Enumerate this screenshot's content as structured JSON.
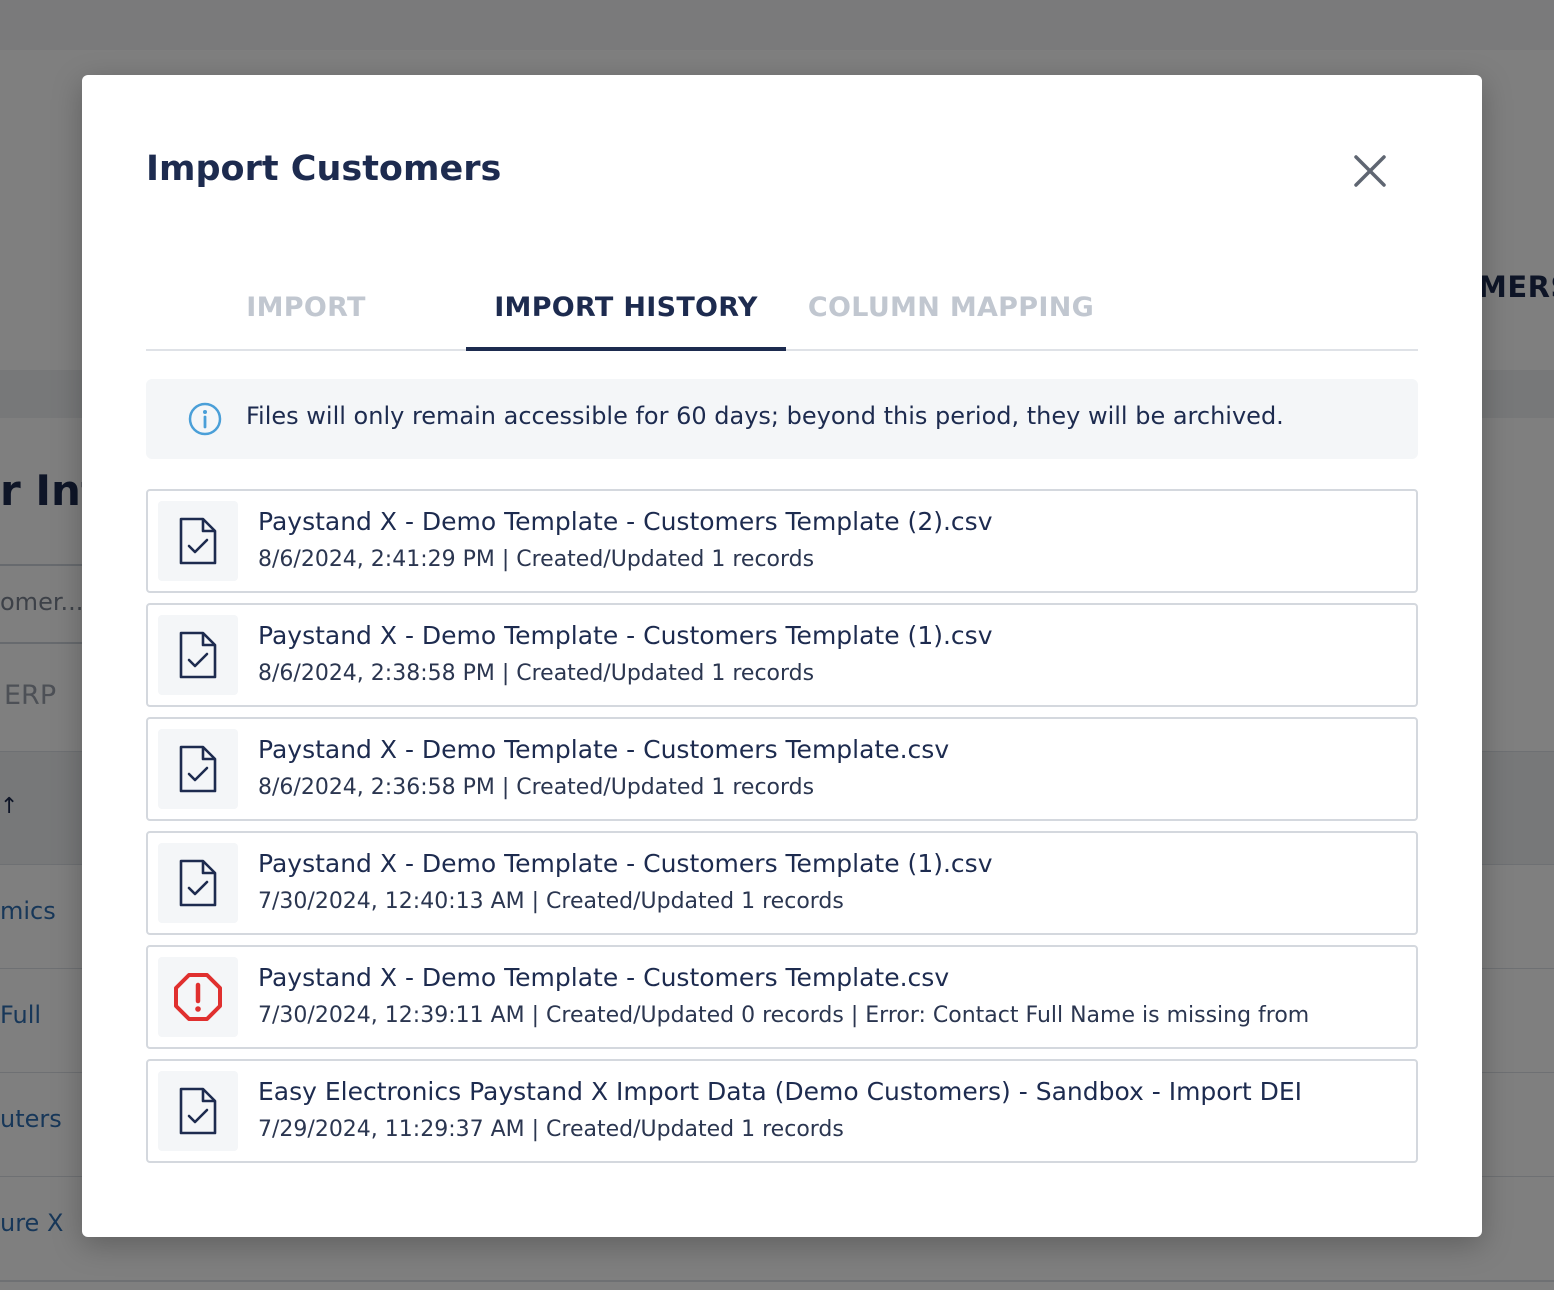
{
  "background": {
    "right_tab_fragment": "MERS",
    "left_title_fragment": "r Inf",
    "left_search_fragment": "omer...",
    "left_erp_fragment": "ERP",
    "table_sort_glyph": "↑",
    "rows": [
      "mics",
      "Full",
      "uters",
      "ure X"
    ]
  },
  "modal": {
    "title": "Import Customers",
    "close_icon": "close-icon",
    "tabs": [
      {
        "label": "IMPORT",
        "active": false
      },
      {
        "label": "IMPORT HISTORY",
        "active": true
      },
      {
        "label": "COLUMN MAPPING",
        "active": false
      }
    ],
    "info": {
      "icon": "info-icon",
      "text": "Files will only remain accessible for 60 days; beyond this period, they will be archived."
    },
    "files": [
      {
        "name": "Paystand X - Demo Template - Customers Template (2).csv",
        "meta": "8/6/2024, 2:41:29 PM | Created/Updated 1 records",
        "status": "success",
        "icon": "file-check-icon"
      },
      {
        "name": "Paystand X - Demo Template - Customers Template (1).csv",
        "meta": "8/6/2024, 2:38:58 PM | Created/Updated 1 records",
        "status": "success",
        "icon": "file-check-icon"
      },
      {
        "name": "Paystand X - Demo Template - Customers Template.csv",
        "meta": "8/6/2024, 2:36:58 PM | Created/Updated 1 records",
        "status": "success",
        "icon": "file-check-icon"
      },
      {
        "name": "Paystand X - Demo Template - Customers Template (1).csv",
        "meta": "7/30/2024, 12:40:13 AM | Created/Updated 1 records",
        "status": "success",
        "icon": "file-check-icon"
      },
      {
        "name": "Paystand X - Demo Template - Customers Template.csv",
        "meta": "7/30/2024, 12:39:11 AM | Created/Updated 0 records | Error: Contact Full Name is missing from",
        "status": "error",
        "icon": "error-octagon-icon"
      },
      {
        "name": "Easy Electronics Paystand X Import Data (Demo Customers) - Sandbox - Import DEI",
        "meta": "7/29/2024, 11:29:37 AM | Created/Updated 1 records",
        "status": "success",
        "icon": "file-check-icon"
      }
    ]
  },
  "colors": {
    "navy": "#1d2b4f",
    "tab_inactive": "#c1c7d0",
    "info_blue": "#4a9fd8",
    "error_red": "#e0302f",
    "overlay": "rgba(0,0,0,0.5)"
  }
}
